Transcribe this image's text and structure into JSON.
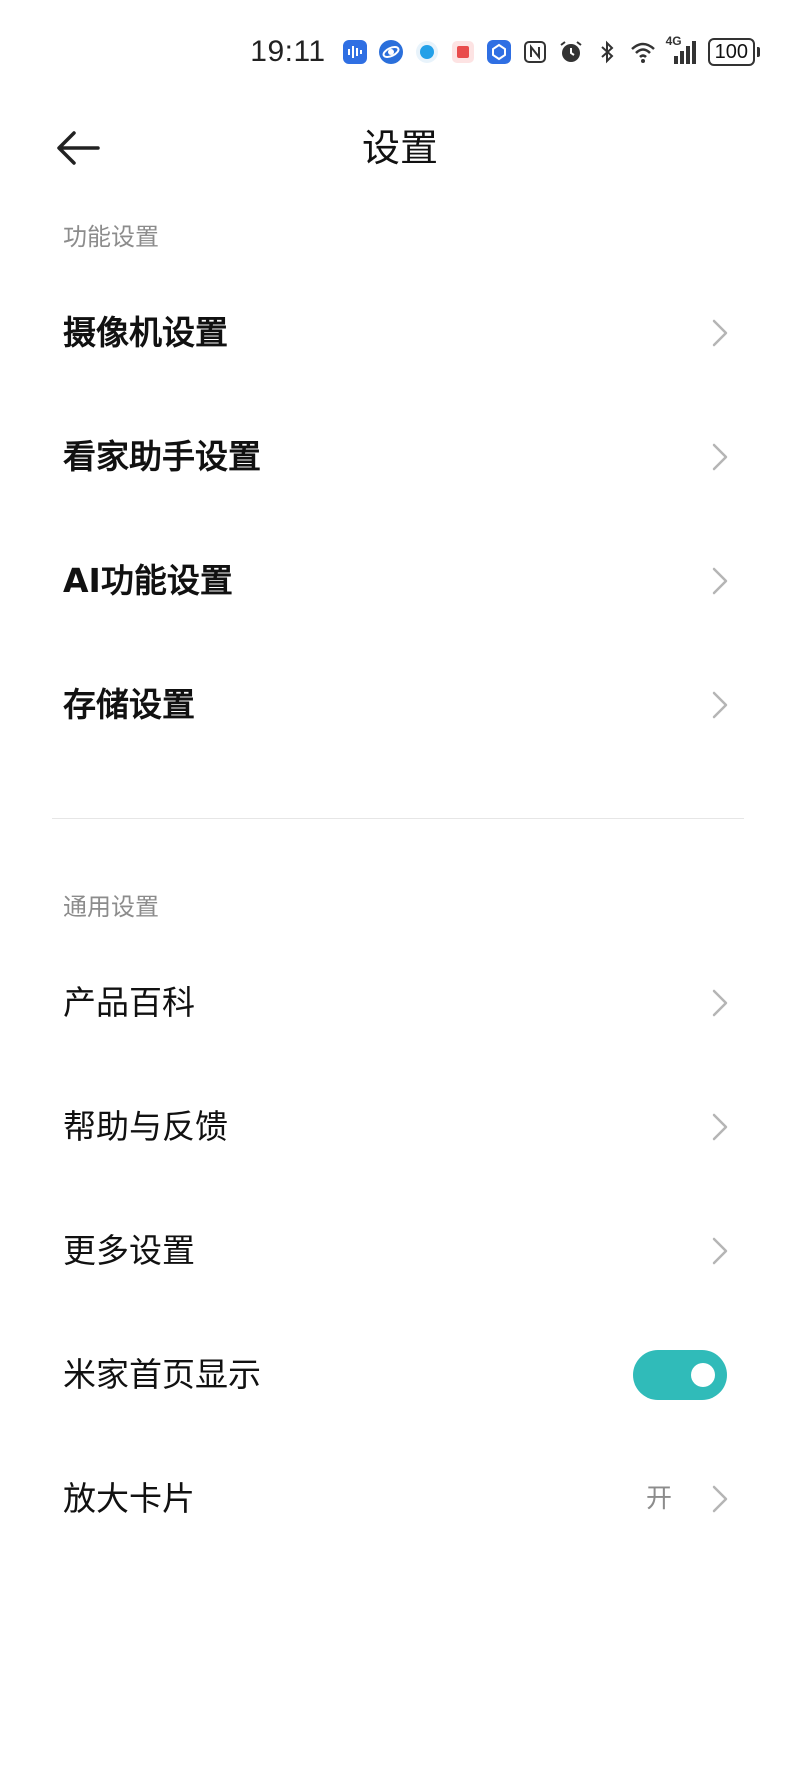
{
  "status_bar": {
    "time": "19:11",
    "battery": "100",
    "network_label": "4G",
    "icons": [
      "voice-app-icon",
      "browser-app-icon",
      "game-app-icon",
      "red-app-icon",
      "blue-app-icon",
      "nfc-icon",
      "alarm-icon",
      "bluetooth-icon",
      "wifi-icon",
      "signal-icon"
    ]
  },
  "header": {
    "title": "设置"
  },
  "sections": [
    {
      "label": "功能设置",
      "items": [
        {
          "label": "摄像机设置"
        },
        {
          "label": "看家助手设置"
        },
        {
          "label": "AI功能设置"
        },
        {
          "label": "存储设置"
        }
      ]
    },
    {
      "label": "通用设置",
      "items": [
        {
          "label": "产品百科"
        },
        {
          "label": "帮助与反馈"
        },
        {
          "label": "更多设置"
        },
        {
          "label": "米家首页显示",
          "toggle_on": true
        },
        {
          "label": "放大卡片",
          "value": "开"
        }
      ]
    }
  ],
  "colors": {
    "accent": "#30bbb9",
    "section_label": "#8c8c8c",
    "text": "#111111"
  }
}
